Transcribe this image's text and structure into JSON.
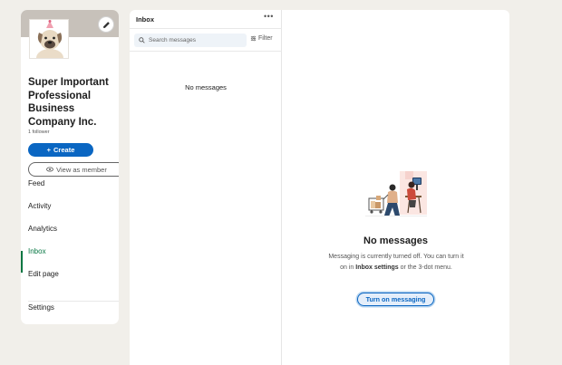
{
  "company": {
    "name": "Super Important Professional Business Company Inc.",
    "followers": "1 follower",
    "create_label": "Create",
    "view_as_member_label": "View as member"
  },
  "nav": [
    {
      "label": "Feed",
      "active": false
    },
    {
      "label": "Activity",
      "active": false
    },
    {
      "label": "Analytics",
      "active": false
    },
    {
      "label": "Inbox",
      "active": true
    },
    {
      "label": "Edit page",
      "active": false
    },
    {
      "label": "Settings",
      "active": false
    }
  ],
  "inbox": {
    "title": "Inbox",
    "more_icon": "ellipsis-icon",
    "search_placeholder": "Search messages",
    "filter_label": "Filter",
    "list_empty": "No messages"
  },
  "empty_state": {
    "title": "No messages",
    "desc_before": "Messaging is currently turned off. You can turn it on in ",
    "desc_bold": "Inbox settings",
    "desc_after": " or the 3-dot menu.",
    "button_label": "Turn on messaging"
  },
  "colors": {
    "accent": "#0a66c2",
    "active_nav": "#057642",
    "background": "#f1efea"
  }
}
